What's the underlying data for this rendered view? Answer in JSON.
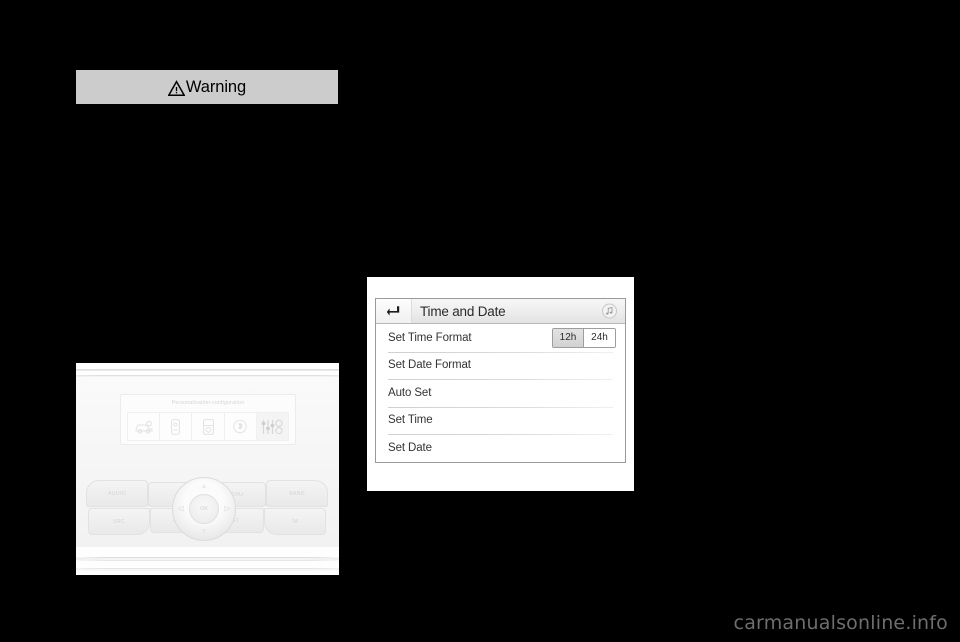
{
  "page": {
    "background_color": "#000000",
    "watermark": "carmanualsonline.info"
  },
  "warning_box": {
    "icon": "warning-triangle-icon",
    "label": "Warning",
    "background_color": "#cccccc",
    "text_color": "#000000"
  },
  "console_photo": {
    "caption": "infotainment-control-panel-photo",
    "display": {
      "title": "Personalisation-configuration",
      "icons": [
        {
          "name": "car-settings-icon"
        },
        {
          "name": "display-icon"
        },
        {
          "name": "radio-icon"
        },
        {
          "name": "bluetooth-icon"
        },
        {
          "name": "sliders-options-icon"
        }
      ]
    },
    "buttons": {
      "top_left": "AUDIO",
      "top_left_2": "♪",
      "bottom_left": "SRC",
      "bottom_left_2": "BACK",
      "top_right": "MENU",
      "top_right_2": "BAND",
      "bottom_right": "LIST",
      "bottom_right_2": "TA",
      "knob_center": "OK"
    }
  },
  "time_and_date_screen": {
    "titlebar": {
      "back_icon": "back-arrow-icon",
      "title": "Time and Date",
      "right_icon": "music-note-icon"
    },
    "rows": [
      {
        "label": "Set Time Format",
        "control": "segmented"
      },
      {
        "label": "Set Date Format",
        "control": "none"
      },
      {
        "label": "Auto Set",
        "control": "none"
      },
      {
        "label": "Set Time",
        "control": "none"
      },
      {
        "label": "Set Date",
        "control": "none"
      }
    ],
    "time_format_options": [
      {
        "label": "12h",
        "selected": true
      },
      {
        "label": "24h",
        "selected": false
      }
    ]
  }
}
